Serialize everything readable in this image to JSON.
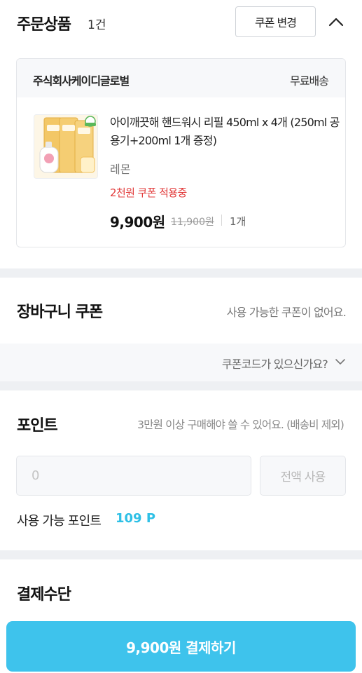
{
  "order": {
    "title": "주문상품",
    "count": "1건",
    "coupon_change_label": "쿠폰 변경"
  },
  "product_card": {
    "seller": "주식회사케이디글로벌",
    "shipping": "무료배송",
    "name": "아이깨끗해 핸드워시 리필 450ml x 4개 (250ml 공용기+200ml 1개 증정)",
    "option": "레몬",
    "coupon_applied": "2천원 쿠폰 적용중",
    "sale_price": "9,900원",
    "original_price": "11,900원",
    "quantity": "1개"
  },
  "cart_coupon": {
    "title": "장바구니 쿠폰",
    "message": "사용 가능한 쿠폰이 없어요.",
    "code_link": "쿠폰코드가 있으신가요?"
  },
  "points": {
    "title": "포인트",
    "notice": "3만원 이상 구매해야 쓸 수 있어요. (배송비 제외)",
    "input_placeholder": "0",
    "use_all_label": "전액 사용",
    "available_label": "사용 가능 포인트",
    "available_value": "109 P"
  },
  "payment": {
    "title": "결제수단",
    "pay_button_label": "9,900원 결제하기"
  },
  "colors": {
    "accent": "#3ec3ec",
    "points_value": "#2ec0e6",
    "coupon_red": "#e23b3b",
    "section_gap": "#eef0f3"
  },
  "icons": {
    "collapse": "chevron-up-icon",
    "coupon_code": "chevron-down-icon"
  }
}
